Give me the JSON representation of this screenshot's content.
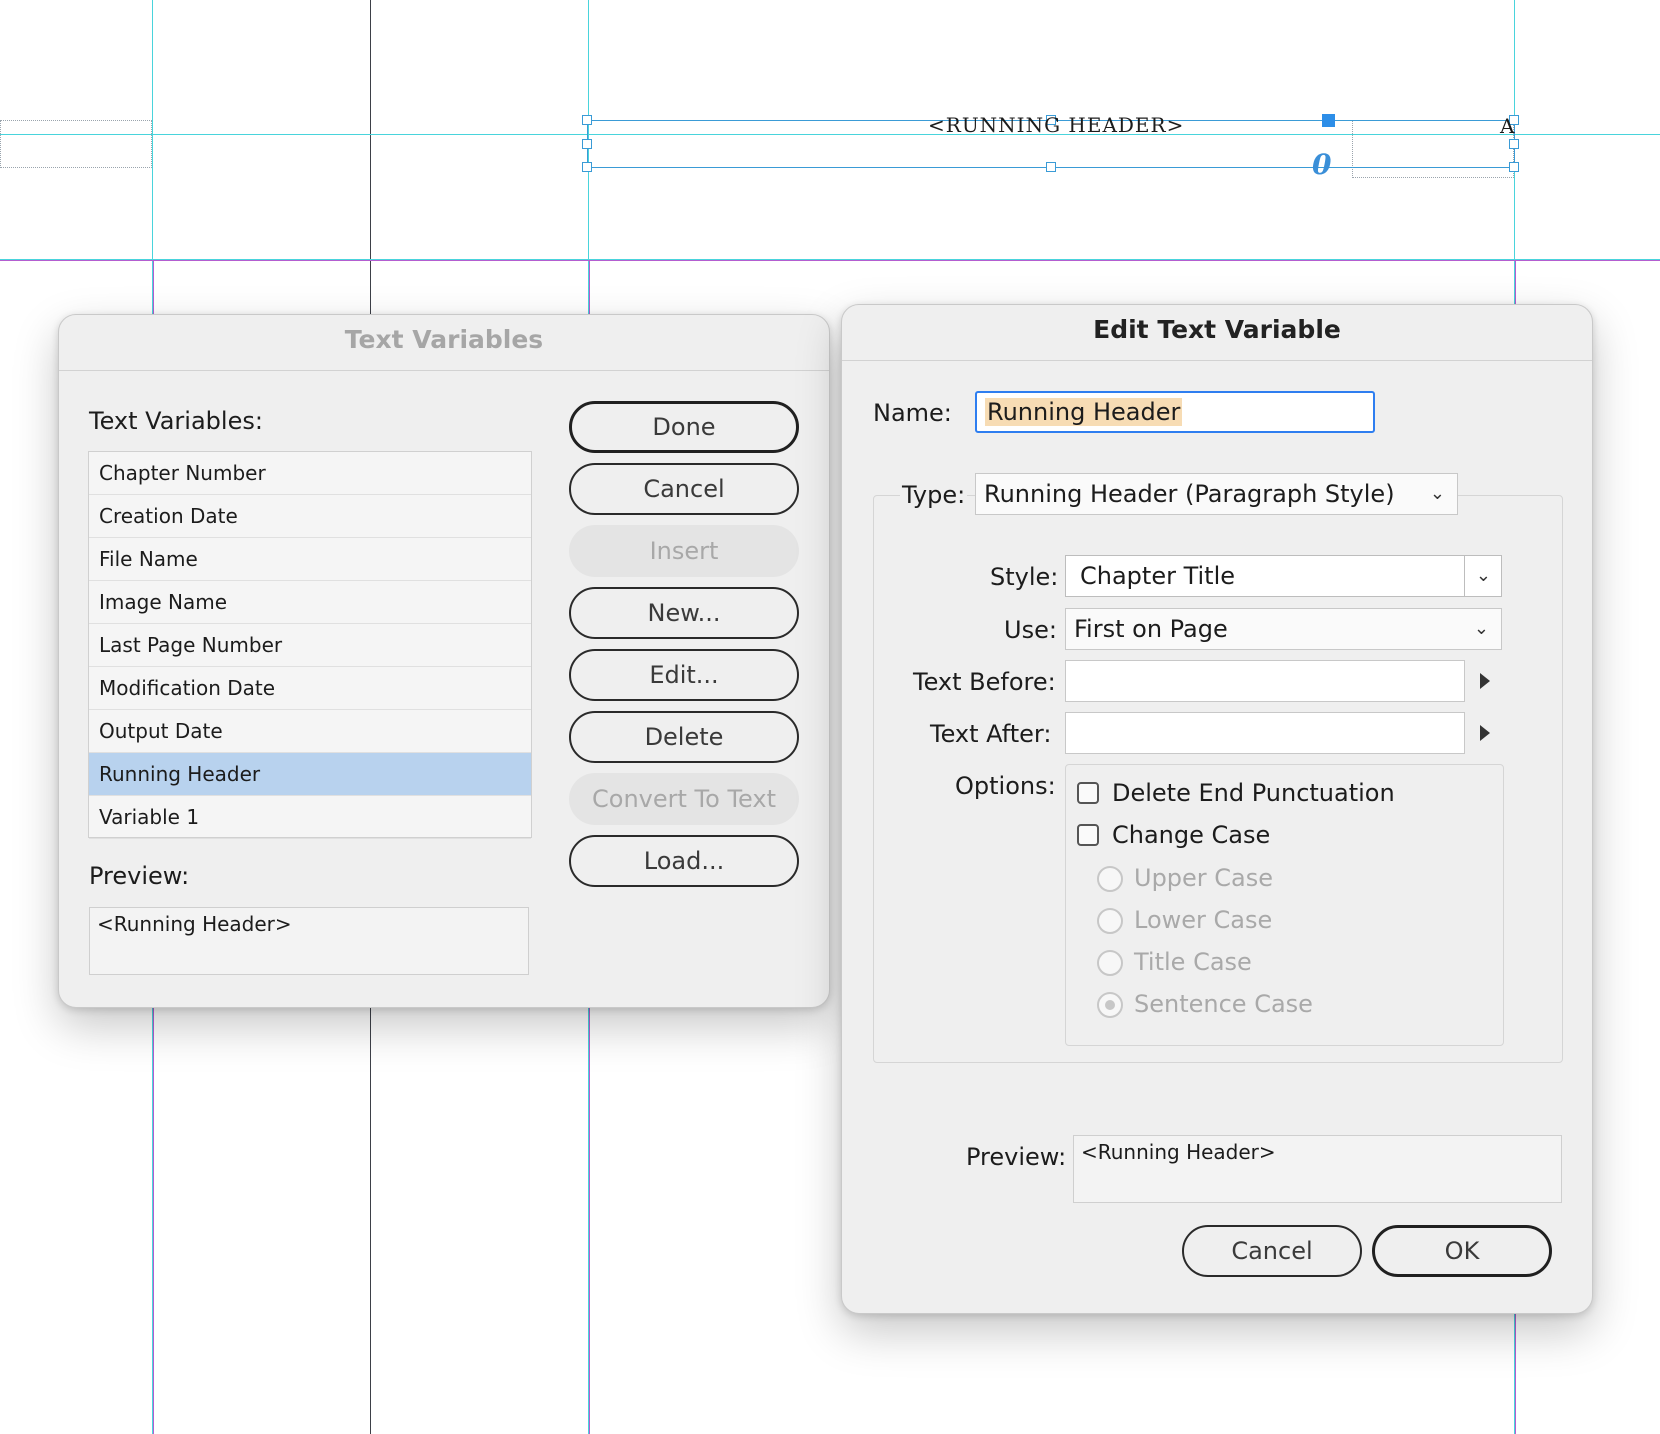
{
  "page": {
    "header_text": "<RUNNING HEADER>",
    "overset_mark": "0",
    "corner_char": "A"
  },
  "text_variables_dialog": {
    "title": "Text Variables",
    "list_label": "Text Variables:",
    "items": [
      {
        "label": "Chapter Number",
        "selected": false
      },
      {
        "label": "Creation Date",
        "selected": false
      },
      {
        "label": "File Name",
        "selected": false
      },
      {
        "label": "Image Name",
        "selected": false
      },
      {
        "label": "Last Page Number",
        "selected": false
      },
      {
        "label": "Modification Date",
        "selected": false
      },
      {
        "label": "Output Date",
        "selected": false
      },
      {
        "label": "Running Header",
        "selected": true
      },
      {
        "label": "Variable 1",
        "selected": false
      }
    ],
    "preview_label": "Preview:",
    "preview_text": "<Running Header>",
    "buttons": {
      "done": "Done",
      "cancel": "Cancel",
      "insert": "Insert",
      "new": "New...",
      "edit": "Edit...",
      "delete": "Delete",
      "convert": "Convert To Text",
      "load": "Load..."
    }
  },
  "edit_dialog": {
    "title": "Edit Text Variable",
    "name_label": "Name:",
    "name_value": "Running Header",
    "type_label": "Type:",
    "type_value": "Running Header (Paragraph Style)",
    "style_label": "Style:",
    "style_value": "Chapter Title",
    "use_label": "Use:",
    "use_value": "First on Page",
    "text_before_label": "Text Before:",
    "text_before_value": "",
    "text_after_label": "Text After:",
    "text_after_value": "",
    "options_label": "Options:",
    "options": {
      "delete_end_punct": {
        "label": "Delete End Punctuation",
        "checked": false
      },
      "change_case": {
        "label": "Change Case",
        "checked": false
      },
      "upper": {
        "label": "Upper Case",
        "selected": false
      },
      "lower": {
        "label": "Lower Case",
        "selected": false
      },
      "title": {
        "label": "Title Case",
        "selected": false
      },
      "sentence": {
        "label": "Sentence Case",
        "selected": true
      }
    },
    "preview_label": "Preview:",
    "preview_text": "<Running Header>",
    "cancel_label": "Cancel",
    "ok_label": "OK"
  }
}
